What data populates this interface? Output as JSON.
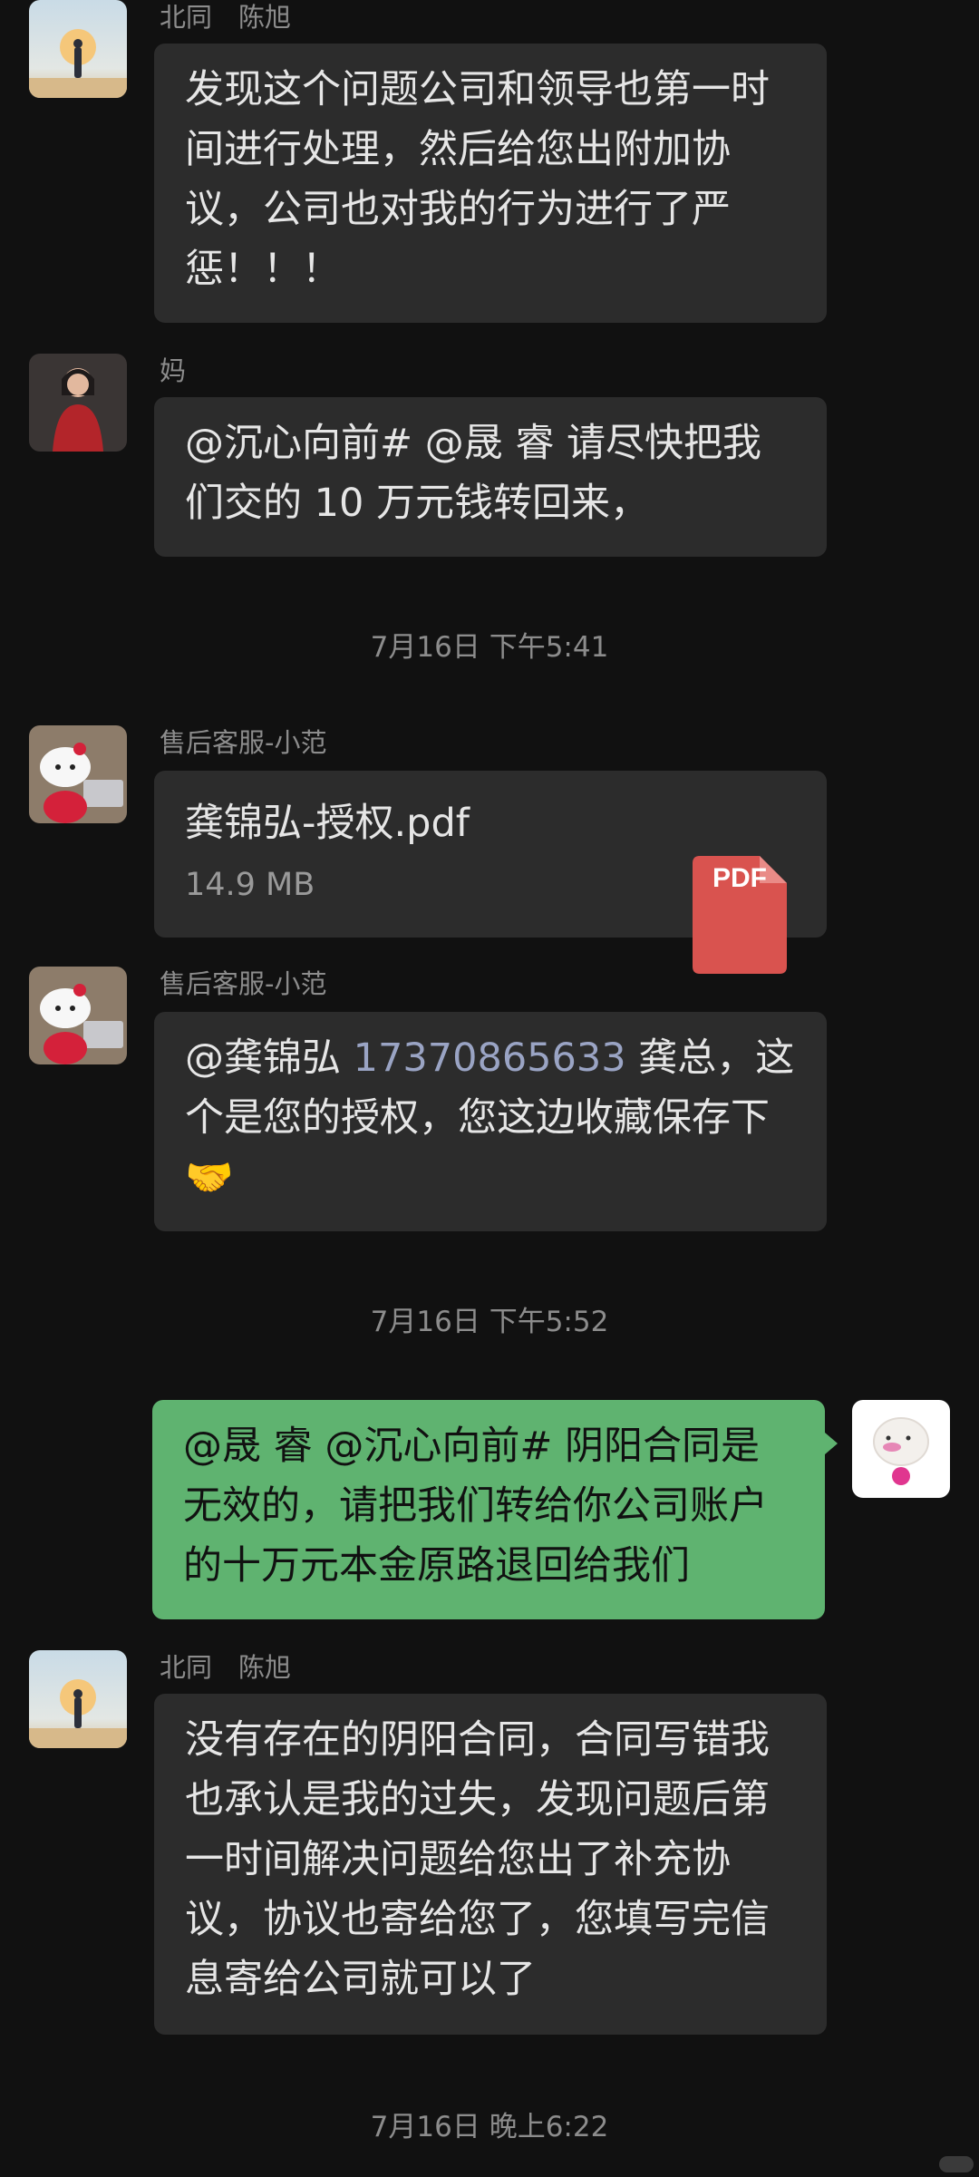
{
  "messages": [
    {
      "sender": "北同　陈旭",
      "text": "发现这个问题公司和领导也第一时\n间进行处理，然后给您出附加协\n议，公司也对我的行为进行了严\n惩！！！"
    },
    {
      "sender": "妈",
      "text": "@沉心向前# @晟 睿  请尽快把我\n们交的 10 万元钱转回来，"
    },
    {
      "timestamp": "7月16日 下午5:41"
    },
    {
      "sender": "售后客服-小范",
      "file": {
        "name": "龚锦弘-授权.pdf",
        "size": "14.9 MB",
        "icon": "pdf-file-icon",
        "icon_label": "PDF",
        "icon_color": "#d9534f"
      }
    },
    {
      "sender": "售后客服-小范",
      "text_before_phone": "@龚锦弘 ",
      "phone": "17370865633",
      "text_after_phone": " 龚总，这\n个是您的授权，您这边收藏保存下",
      "emoji": "🤝"
    },
    {
      "timestamp": "7月16日 下午5:52"
    },
    {
      "sender": "",
      "text": "@晟 睿 @沉心向前#  阴阳合同是\n无效的，请把我们转给你公司账户\n的十万元本金原路退回给我们",
      "outgoing": true
    },
    {
      "sender": "北同　陈旭",
      "text": "没有存在的阴阳合同，合同写错我\n也承认是我的过失，发现问题后第\n一时间解决问题给您出了补充协\n议，协议也寄给您了，您填写完信\n息寄给公司就可以了"
    },
    {
      "timestamp": "7月16日 晚上6:22"
    }
  ],
  "colors": {
    "background": "#111111",
    "incoming_bubble": "#2c2c2c",
    "outgoing_bubble": "#5fb370",
    "phone_link": "#9aa4c4",
    "timestamp": "#8c8c8c"
  }
}
